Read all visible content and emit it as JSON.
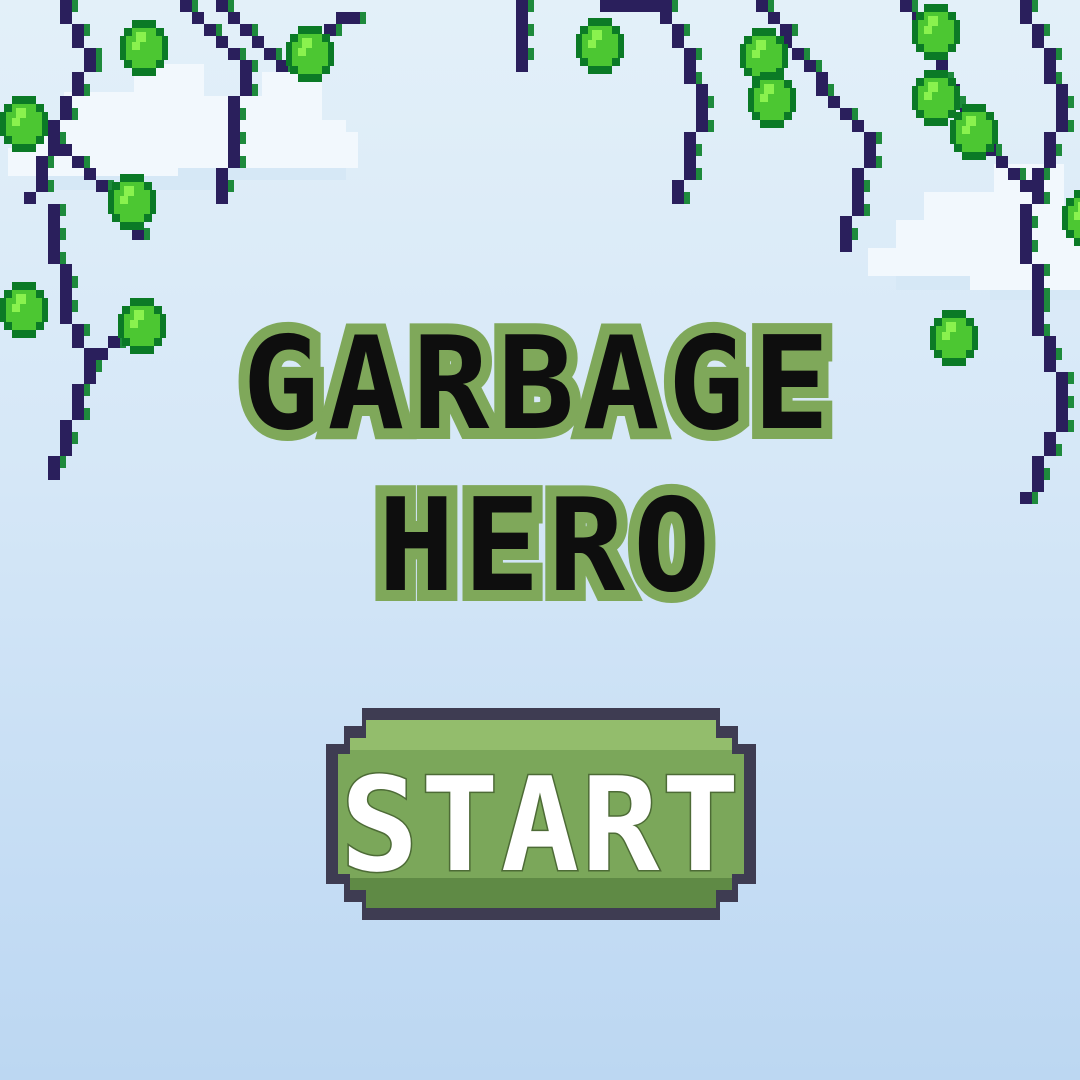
{
  "game": {
    "title_line_1": "GARBAGE",
    "title_line_2": "HERO",
    "start_label": "START"
  },
  "colors": {
    "sky_top": "#e3f0f9",
    "sky_bottom": "#bcd7f2",
    "cloud": "#f2f8fd",
    "cloud_shade": "#d6e8f6",
    "vine_stem": "#2a1f5c",
    "vine_stem_accent": "#1e8a3c",
    "leaf_outline": "#0b7a26",
    "leaf_fill": "#4cc732",
    "leaf_highlight": "#8af24e",
    "title_fill": "#0e0e0e",
    "title_outline": "#7fa85a",
    "title_outline_dark": "#4d6b36",
    "button_fill": "#7ba75a",
    "button_top": "#93bd6c",
    "button_border": "#3e3c52",
    "button_text": "#ffffff"
  },
  "icons": {
    "decoration": "hanging-vine-icon",
    "leaf": "leaf-icon",
    "cloud": "cloud-icon"
  }
}
